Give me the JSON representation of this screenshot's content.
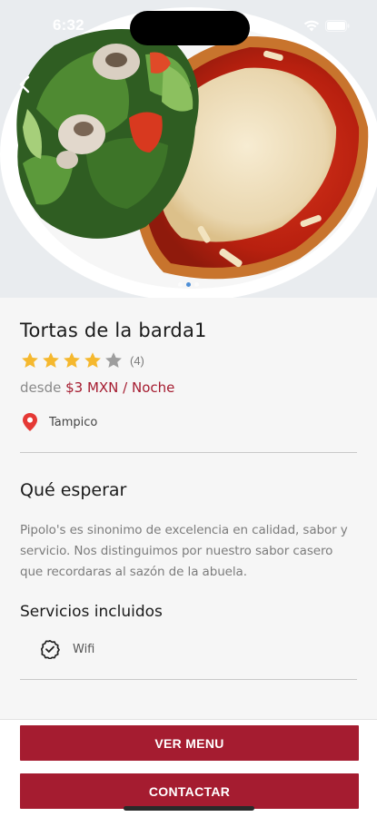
{
  "status_bar": {
    "time": "6:32"
  },
  "hero": {
    "image": "plate-of-milanesa-with-salad",
    "pager_count": 3,
    "pager_active": 1
  },
  "place": {
    "title": "Tortas de la barda1",
    "rating": 4,
    "rating_max": 5,
    "rating_count_label": "(4)",
    "price_prefix": "desde",
    "price_value": "$3 MXN / Noche",
    "location": "Tampico"
  },
  "about": {
    "title": "Qué esperar",
    "description": "Pipolo's es sinonimo de excelencia en calidad, sabor y servicio. Nos distinguimos por nuestro sabor casero que recordaras al sazón de la abuela."
  },
  "services": {
    "title": "Servicios incluidos",
    "items": [
      {
        "label": "Wifi",
        "icon": "check-circle-icon"
      }
    ]
  },
  "actions": {
    "menu_label": "VER MENU",
    "contact_label": "CONTACTAR"
  },
  "colors": {
    "accent": "#a51c30",
    "star": "#f5b82e",
    "star_empty": "#9e9e9e",
    "pin": "#e53935"
  }
}
